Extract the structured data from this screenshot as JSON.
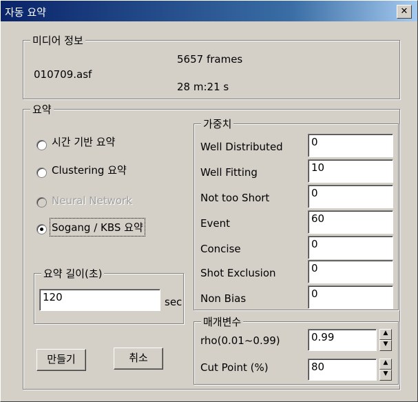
{
  "window": {
    "title": "자동 요약",
    "close_glyph": "✕"
  },
  "media_info": {
    "group_label": "미디어 정보",
    "filename": "010709.asf",
    "frames": "5657 frames",
    "duration": "28 m:21 s"
  },
  "summary": {
    "group_label": "요약",
    "methods": [
      {
        "label": "시간 기반 요약",
        "checked": false,
        "enabled": true
      },
      {
        "label": "Clustering 요약",
        "checked": false,
        "enabled": true
      },
      {
        "label": "Neural Network",
        "checked": false,
        "enabled": false
      },
      {
        "label": "Sogang / KBS 요약",
        "checked": true,
        "enabled": true
      }
    ],
    "length": {
      "group_label": "요약 길이(초)",
      "value": "120",
      "unit": "sec"
    }
  },
  "weights": {
    "group_label": "가중치",
    "rows": [
      {
        "label": "Well Distributed",
        "value": "0"
      },
      {
        "label": "Well Fitting",
        "value": "10"
      },
      {
        "label": "Not too Short",
        "value": "0"
      },
      {
        "label": "Event",
        "value": "60"
      },
      {
        "label": "Concise",
        "value": "0"
      },
      {
        "label": "Shot Exclusion",
        "value": "0"
      },
      {
        "label": "Non Bias",
        "value": "0"
      }
    ]
  },
  "params": {
    "group_label": "매개변수",
    "rows": [
      {
        "label": "rho(0.01~0.99)",
        "value": "0.99"
      },
      {
        "label": "Cut Point (%)",
        "value": "80"
      }
    ]
  },
  "buttons": {
    "create": "만들기",
    "cancel": "취소"
  }
}
